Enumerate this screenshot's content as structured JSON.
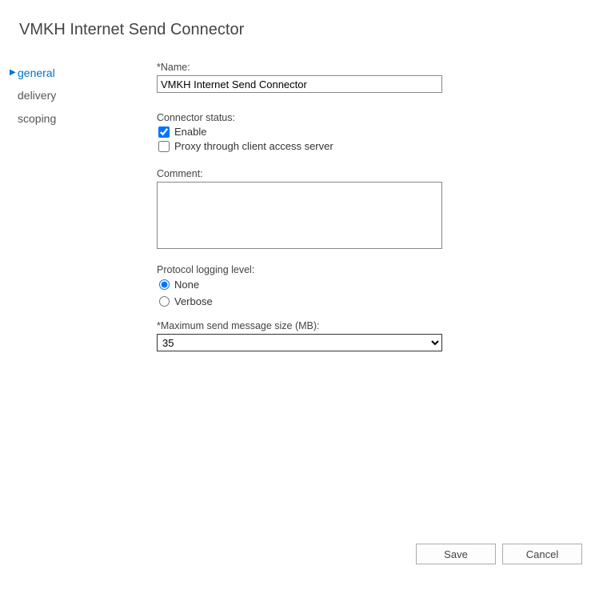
{
  "page_title": "VMKH Internet Send Connector",
  "sidebar": {
    "items": [
      {
        "label": "general"
      },
      {
        "label": "delivery"
      },
      {
        "label": "scoping"
      }
    ]
  },
  "form": {
    "name_label": "*Name:",
    "name_value": "VMKH Internet Send Connector",
    "connector_status_label": "Connector status:",
    "enable_label": "Enable",
    "proxy_label": "Proxy through client access server",
    "comment_label": "Comment:",
    "comment_value": "",
    "proto_label": "Protocol logging level:",
    "proto_none_label": "None",
    "proto_verbose_label": "Verbose",
    "maxsize_label": "*Maximum send message size (MB):",
    "maxsize_value": "35"
  },
  "footer": {
    "save_label": "Save",
    "cancel_label": "Cancel"
  }
}
